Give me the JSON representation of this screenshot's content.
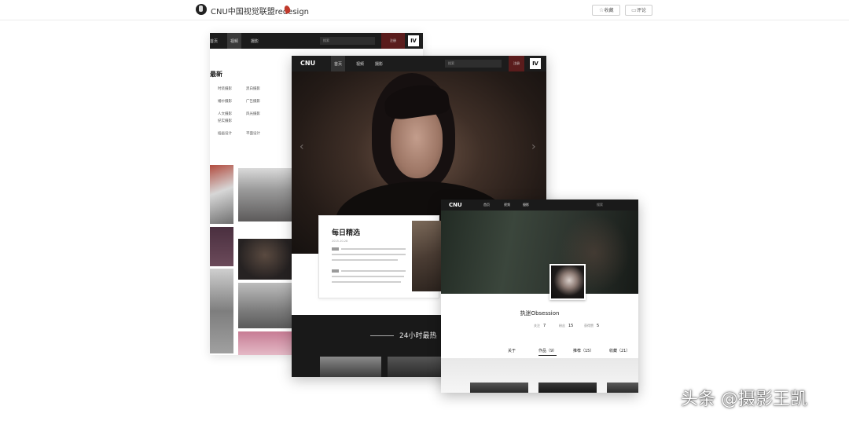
{
  "header": {
    "project_title": "CNU中国视觉联盟redesign",
    "collect_label": "收藏",
    "comment_label": "评论"
  },
  "back_page": {
    "nav": [
      "首页",
      "视频",
      "摄影"
    ],
    "search_placeholder": "搜索",
    "login_label": "注册",
    "section_title": "最新",
    "categories": [
      "时装摄影",
      "黑白摄影",
      "婚纱摄影",
      "广告摄影",
      "人文摄影",
      "风光摄影",
      "纪实摄影",
      "插画设计",
      "平面设计"
    ]
  },
  "middle_page": {
    "logo": "CNU",
    "nav": [
      "首页",
      "视频",
      "摄影"
    ],
    "search_placeholder": "搜索",
    "login_label": "注册",
    "daily_title": "每日精选",
    "daily_date": "2015-10-28",
    "band_title": "24小时最热"
  },
  "front_page": {
    "logo": "CNU",
    "nav": [
      "首页",
      "视频",
      "摄影"
    ],
    "search_placeholder": "搜索",
    "profile_name": "执迷Obsession",
    "stats": [
      {
        "label": "关注",
        "value": "7"
      },
      {
        "label": "粉丝",
        "value": "15"
      },
      {
        "label": "获得赞",
        "value": "5"
      }
    ],
    "tabs": [
      "关于",
      "作品（9）",
      "推荐（15）",
      "收藏（21）"
    ]
  },
  "watermark": "头条 @摄影王凯",
  "colors": {
    "nav_bg": "#1c1c1c",
    "login_red": "#5a1c1c",
    "page_bg": "#ffffff"
  }
}
